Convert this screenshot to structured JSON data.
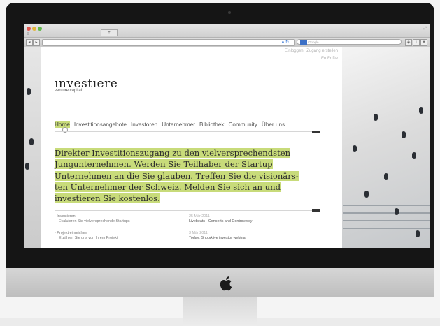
{
  "browser": {
    "tab_label": "+",
    "search_placeholder": "Google"
  },
  "page": {
    "top_links": [
      "Einloggen",
      "Zugang erstellen"
    ],
    "languages": "En Fr De",
    "logo": "ınvestıere",
    "tagline": "venture capital",
    "nav": [
      "Home",
      "Investitionsangebote",
      "Investoren",
      "Unternehmer",
      "Bibliothek",
      "Community",
      "Über uns"
    ],
    "headline_lines": [
      "Direkter Investitionszugang zu den vielversprechendsten",
      "Jungunternehmen. Werden Sie Teilhaber der Startup",
      "Unternehmen an die Sie glauben. Treffen Sie die visionärs-",
      "ten Unternehmer der Schweiz. Melden Sie sich an und",
      "investieren Sie kostenlos."
    ],
    "items": [
      {
        "title": "Investieren",
        "desc": "Evaluieren Sie vielversprechende Startups"
      },
      {
        "title": "Projekt einreichen",
        "desc": "Erzählen Sie uns von Ihrem Projekt"
      }
    ],
    "news": [
      {
        "date": "25 Mär 2011",
        "title": "Livebeats - Concerts and Controversy"
      },
      {
        "date": "3 Mär 2011",
        "title": "Today: ShopAlive investor webinar"
      }
    ]
  },
  "colors": {
    "highlight": "#c8db7a",
    "text": "#2c2c2c",
    "bezel": "#151515"
  },
  "icons": [
    "apple-logo-icon",
    "back-icon",
    "forward-icon",
    "reload-icon",
    "search-icon",
    "menu-icon"
  ]
}
